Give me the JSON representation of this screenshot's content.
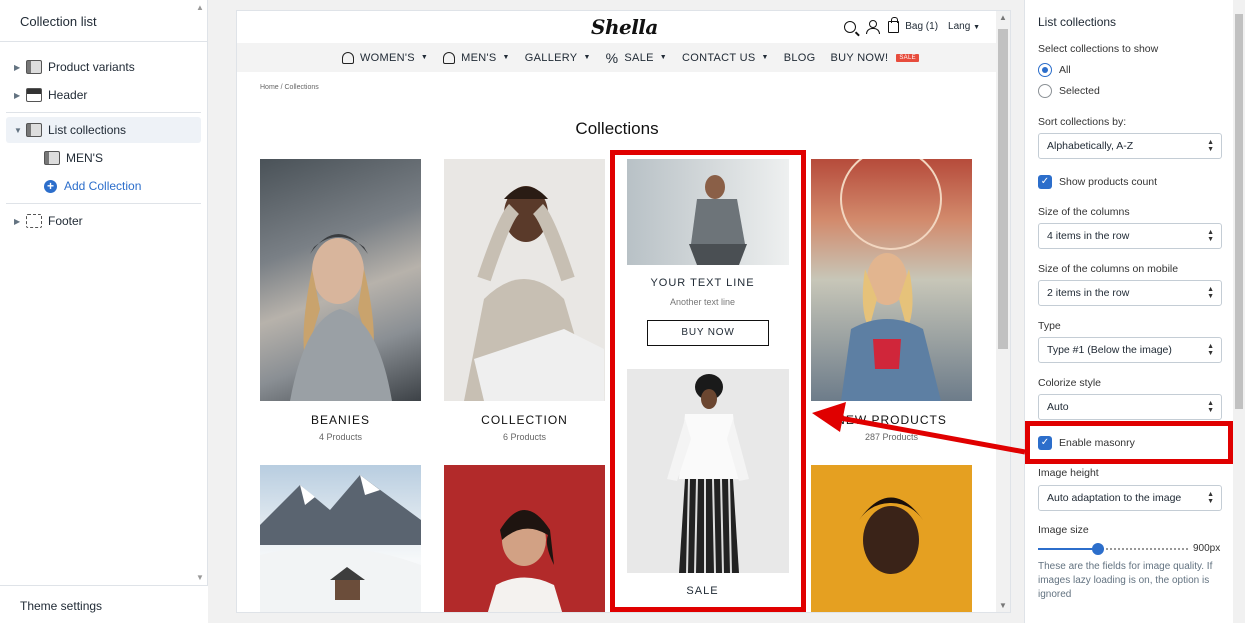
{
  "left_panel": {
    "title": "Collection list",
    "items": [
      {
        "label": "Product variants"
      },
      {
        "label": "Header"
      },
      {
        "label": "List collections"
      },
      {
        "label": "MEN'S"
      },
      {
        "label": "Add Collection"
      },
      {
        "label": "Footer"
      }
    ],
    "footer": "Theme settings"
  },
  "store": {
    "logo": "Shella",
    "bag": "Bag (1)",
    "lang": "Lang",
    "nav": [
      {
        "label": "WOMEN'S"
      },
      {
        "label": "MEN'S"
      },
      {
        "label": "GALLERY"
      },
      {
        "label": "SALE"
      },
      {
        "label": "CONTACT US"
      },
      {
        "label": "BLOG"
      },
      {
        "label": "BUY NOW!"
      }
    ],
    "sale_badge": "SALE",
    "breadcrumb": "Home  /  Collections",
    "heading": "Collections",
    "cards": [
      {
        "title": "BEANIES",
        "count": "4 Products"
      },
      {
        "title": "COLLECTION",
        "count": "6 Products"
      },
      {
        "title": "NEW PRODUCTS",
        "count": "287 Products"
      }
    ],
    "promo": {
      "title": "YOUR TEXT LINE",
      "subtitle": "Another text line",
      "button": "BUY NOW",
      "sale_title": "SALE"
    }
  },
  "settings": {
    "title": "List collections",
    "select_label": "Select collections to show",
    "radio_all": "All",
    "radio_selected": "Selected",
    "sort_label": "Sort collections by:",
    "sort_value": "Alphabetically, A-Z",
    "show_count": "Show products count",
    "size_label": "Size of the columns",
    "size_value": "4 items in the row",
    "mobile_label": "Size of the columns on mobile",
    "mobile_value": "2 items in the row",
    "type_label": "Type",
    "type_value": "Type #1 (Below the image)",
    "colorize_label": "Colorize style",
    "colorize_value": "Auto",
    "masonry": "Enable masonry",
    "height_label": "Image height",
    "height_value": "Auto adaptation to the image",
    "imgsize_label": "Image size",
    "imgsize_value": "900px",
    "imgsize_fraction": 0.4,
    "help": "These are the fields for image quality. If images lazy loading is on, the option is ignored"
  },
  "colors": {
    "accent": "#2c6ecb",
    "annotation_red": "#e00000",
    "sale_badge": "#e74c3c"
  }
}
